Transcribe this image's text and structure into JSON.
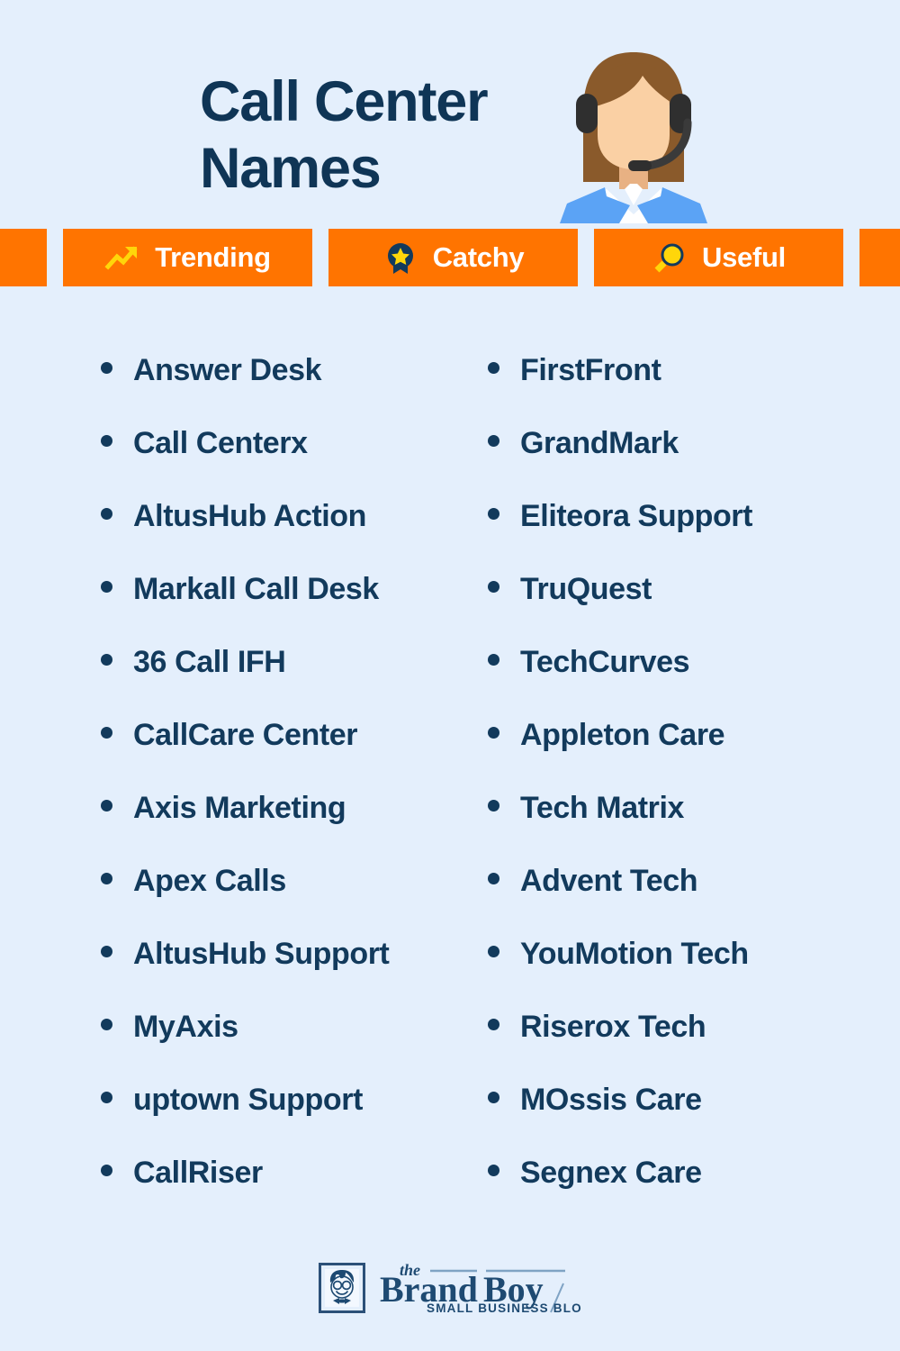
{
  "page": {
    "background_color": "#e4effc",
    "accent_color": "#ff7400",
    "text_color": "#123a5c",
    "icon_highlight_color": "#ffd60a"
  },
  "header": {
    "title_line1": "Call Center",
    "title_line2": "Names",
    "illustration": "call-center-agent-with-headset"
  },
  "banner": {
    "badges": [
      {
        "label": "Trending",
        "icon": "trending-up-arrow-icon"
      },
      {
        "label": "Catchy",
        "icon": "award-ribbon-star-icon"
      },
      {
        "label": "Useful",
        "icon": "magnifying-glass-icon"
      }
    ]
  },
  "main": {
    "left_column": [
      "Answer Desk",
      "Call Centerx",
      "AltusHub Action",
      "Markall Call Desk",
      "36 Call IFH",
      "CallCare Center",
      "Axis Marketing",
      "Apex Calls",
      "AltusHub Support",
      "MyAxis",
      "uptown Support",
      "CallRiser"
    ],
    "right_column": [
      "FirstFront",
      "GrandMark",
      "Eliteora Support",
      "TruQuest",
      "TechCurves",
      "Appleton Care",
      "Tech Matrix",
      "Advent Tech",
      "YouMotion Tech",
      "Riserox Tech",
      "MOssis Care",
      "Segnex Care"
    ]
  },
  "footer": {
    "logo_the": "the",
    "logo_brand": "Brand",
    "logo_boy": "Boy",
    "logo_tagline": "SMALL BUSINESS BLOG",
    "logo_mark": "brandboy-boy-face-icon"
  }
}
